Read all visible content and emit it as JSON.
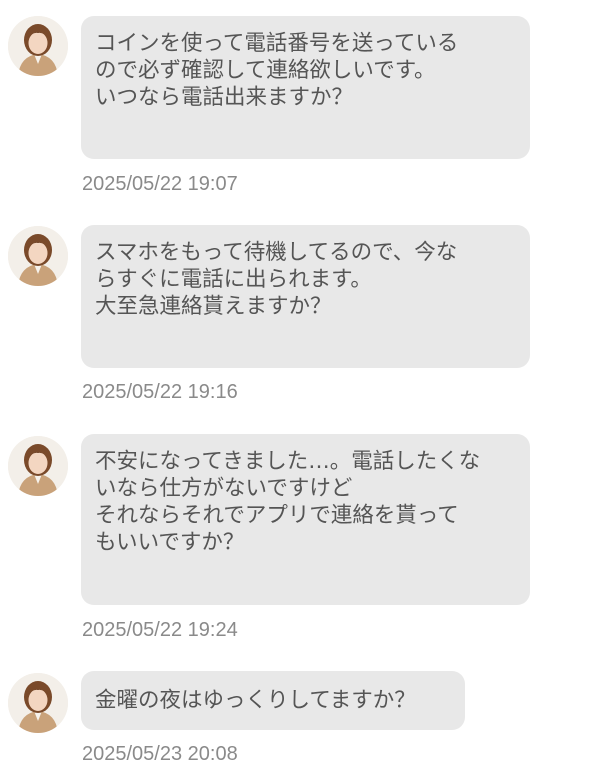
{
  "messages": [
    {
      "text": "コインを使って電話番号を送っている\nので必ず確認して連絡欲しいです。\nいつなら電話出来ますか？",
      "time": "2025/05/22 19:07"
    },
    {
      "text": "スマホをもって待機してるので、今な\nらすぐに電話に出られます。\n大至急連絡貰えますか？",
      "time": "2025/05/22 19:16"
    },
    {
      "text": "不安になってきました…。電話したくな\nいなら仕方がないですけど\nそれならそれでアプリで連絡を貰って\nもいいですか？",
      "time": "2025/05/22 19:24"
    },
    {
      "text": "金曜の夜はゆっくりしてますか？",
      "time": "2025/05/23 20:08"
    }
  ],
  "colors": {
    "bubble_bg": "#e8e8e8",
    "text": "#555555",
    "timestamp": "#8a8a8a"
  }
}
